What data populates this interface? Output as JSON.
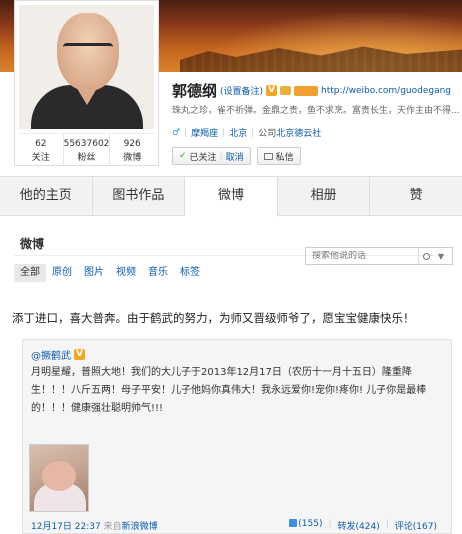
{
  "profile": {
    "name": "郭德纲",
    "remark_link": "(设置备注)",
    "verified_badge": "V",
    "url": "http://weibo.com/guodegang",
    "intro": "珠丸之珍，雀不祈弹。金鼎之贵，鱼不求烹。富贵长生，天作主由不得...",
    "gender_symbol": "♂",
    "constellation": "摩羯座",
    "location": "北京",
    "company_prefix": "公司",
    "company": "北京德云社",
    "followed_label": "已关注",
    "cancel_label": "取消",
    "message_label": "私信",
    "stats": [
      {
        "num": "62",
        "label": "关注"
      },
      {
        "num": "55637602",
        "label": "粉丝"
      },
      {
        "num": "926",
        "label": "微博"
      }
    ]
  },
  "tabs": [
    "他的主页",
    "图书作品",
    "微博",
    "相册",
    "赞"
  ],
  "active_tab": "微博",
  "feed": {
    "title": "微博",
    "search_placeholder": "搜索他说的话",
    "filters": [
      "全部",
      "原创",
      "图片",
      "视频",
      "音乐",
      "标签"
    ]
  },
  "post": {
    "text": "添丁进口，喜大普奔。由于鹤武的努力，为师又晋级师爷了，愿宝宝健康快乐！",
    "repost": {
      "author": "@撅鹤武",
      "badge": "V",
      "text": "月明星耀，普照大地！我们的大儿子于2013年12月17日（农历十一月十五日）隆重降生！！！八斤五两！母子平安！儿子他妈你真伟大！我永远爱你!宠你!疼你! 儿子你是最棒的！！！健康强壮聪明帅气!!!",
      "time": "12月17日 22:37",
      "source_prefix": "来自",
      "source": "新浪微博",
      "likes": "(155)",
      "reposts": "转发(424)",
      "comments": "评论(167)"
    }
  }
}
